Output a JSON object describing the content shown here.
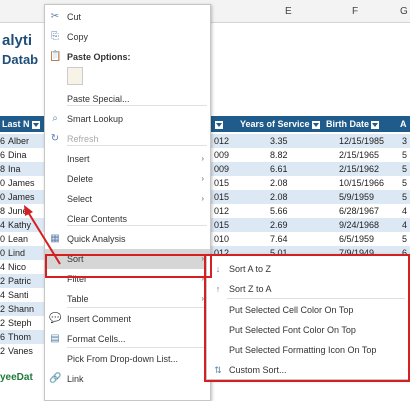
{
  "sheet": {
    "col_headers": [
      "E",
      "F",
      "G"
    ],
    "title_line1": "alyti",
    "title_line2": "Datab",
    "headers": [
      "Last N",
      "",
      "Years of Service",
      "Birth Date",
      "A"
    ],
    "rows": [
      {
        "id": "6",
        "name": "Alber",
        "code": "012",
        "years": "3.35",
        "birth": "12/15/1985",
        "a": "3"
      },
      {
        "id": "6",
        "name": "Dina",
        "code": "009",
        "years": "8.82",
        "birth": "2/15/1965",
        "a": "5"
      },
      {
        "id": "8",
        "name": "Ina",
        "code": "009",
        "years": "6.61",
        "birth": "2/15/1962",
        "a": "5"
      },
      {
        "id": "0",
        "name": "James",
        "code": "015",
        "years": "2.08",
        "birth": "10/15/1966",
        "a": "5"
      },
      {
        "id": "0",
        "name": "James",
        "code": "015",
        "years": "2.08",
        "birth": "5/9/1959",
        "a": "5"
      },
      {
        "id": "8",
        "name": "June",
        "code": "012",
        "years": "5.66",
        "birth": "6/28/1967",
        "a": "4"
      },
      {
        "id": "4",
        "name": "Kathy",
        "code": "015",
        "years": "2.69",
        "birth": "9/24/1968",
        "a": "4"
      },
      {
        "id": "0",
        "name": "Lean",
        "code": "010",
        "years": "7.64",
        "birth": "6/5/1959",
        "a": "5"
      },
      {
        "id": "0",
        "name": "Lind",
        "code": "012",
        "years": "5.01",
        "birth": "7/9/1949",
        "a": "6"
      },
      {
        "id": "4",
        "name": "Nico",
        "code": "",
        "years": "",
        "birth": "",
        "a": ""
      },
      {
        "id": "2",
        "name": "Patric",
        "code": "",
        "years": "",
        "birth": "",
        "a": ""
      },
      {
        "id": "4",
        "name": "Santi",
        "code": "",
        "years": "",
        "birth": "",
        "a": ""
      },
      {
        "id": "2",
        "name": "Shann",
        "code": "",
        "years": "",
        "birth": "",
        "a": ""
      },
      {
        "id": "2",
        "name": "Steph",
        "code": "",
        "years": "",
        "birth": "",
        "a": ""
      },
      {
        "id": "6",
        "name": "Thom",
        "code": "",
        "years": "",
        "birth": "",
        "a": ""
      },
      {
        "id": "2",
        "name": "Vanes",
        "code": "",
        "years": "",
        "birth": "",
        "a": ""
      }
    ],
    "footer": "yeeDat"
  },
  "menu": {
    "items": [
      {
        "label": "Cut",
        "icon": "scissors-icon",
        "glyph": "✂"
      },
      {
        "label": "Copy",
        "icon": "copy-icon",
        "glyph": "⎘"
      },
      {
        "label": "Paste Options:",
        "icon": "paste-icon",
        "glyph": "📋"
      },
      {
        "label": "Paste Special...",
        "icon": "",
        "glyph": ""
      },
      {
        "label": "Smart Lookup",
        "icon": "search-icon",
        "glyph": "⌕"
      },
      {
        "label": "Refresh",
        "icon": "refresh-icon",
        "glyph": "↻"
      },
      {
        "label": "Insert",
        "icon": "",
        "glyph": ""
      },
      {
        "label": "Delete",
        "icon": "",
        "glyph": ""
      },
      {
        "label": "Select",
        "icon": "",
        "glyph": ""
      },
      {
        "label": "Clear Contents",
        "icon": "",
        "glyph": ""
      },
      {
        "label": "Quick Analysis",
        "icon": "quick-analysis-icon",
        "glyph": "▦"
      },
      {
        "label": "Sort",
        "icon": "",
        "glyph": ""
      },
      {
        "label": "Filter",
        "icon": "",
        "glyph": ""
      },
      {
        "label": "Table",
        "icon": "",
        "glyph": ""
      },
      {
        "label": "Insert Comment",
        "icon": "comment-icon",
        "glyph": "💬"
      },
      {
        "label": "Format Cells...",
        "icon": "format-cells-icon",
        "glyph": "▤"
      },
      {
        "label": "Pick From Drop-down List...",
        "icon": "",
        "glyph": ""
      },
      {
        "label": "Link",
        "icon": "link-icon",
        "glyph": "🔗"
      }
    ]
  },
  "submenu": {
    "items": [
      {
        "label": "Sort A to Z",
        "icon": "sort-asc-icon",
        "glyph": "↓"
      },
      {
        "label": "Sort Z to A",
        "icon": "sort-desc-icon",
        "glyph": "↑"
      },
      {
        "label": "Put Selected Cell Color On Top",
        "icon": "",
        "glyph": ""
      },
      {
        "label": "Put Selected Font Color On Top",
        "icon": "",
        "glyph": ""
      },
      {
        "label": "Put Selected Formatting Icon On Top",
        "icon": "",
        "glyph": ""
      },
      {
        "label": "Custom Sort...",
        "icon": "custom-sort-icon",
        "glyph": "⇅"
      }
    ]
  },
  "colors": {
    "accent_red": "#d42020",
    "table_header": "#1f5c8b",
    "band": "#dce8f4"
  }
}
